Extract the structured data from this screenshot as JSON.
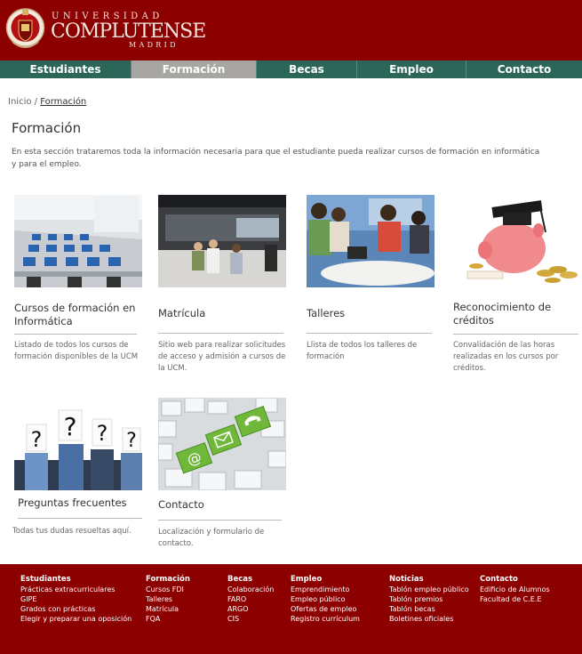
{
  "header": {
    "brand_top": "UNIVERSIDAD",
    "brand_main": "COMPLUTENSE",
    "brand_bottom": "MADRID"
  },
  "nav": {
    "items": [
      {
        "label": "Estudiantes"
      },
      {
        "label": "Formación"
      },
      {
        "label": "Becas"
      },
      {
        "label": "Empleo"
      },
      {
        "label": "Contacto"
      }
    ],
    "active": "Formación"
  },
  "breadcrumb": {
    "home": "Inicio",
    "sep": "/",
    "current": "Formación"
  },
  "page": {
    "title": "Formación",
    "intro": "En esta sección trataremos toda la información necesaria para que el estudiante pueda realizar cursos de formación en informática y para el empleo."
  },
  "cards": [
    {
      "title": "Cursos de formación en Informática",
      "desc": "Listado de todos los cursos de formación disponibles de la UCM"
    },
    {
      "title": "Matrícula",
      "desc": "Sitio web para realizar solicitudes de acceso y admisión a cursos de la UCM."
    },
    {
      "title": "Talleres",
      "desc": "Llista de todos los talleres de formación"
    },
    {
      "title": "Reconocimiento de créditos",
      "desc": "Convalidación de las horas realizadas en los cursos por créditos."
    },
    {
      "title": "Preguntas frecuentes",
      "desc": "Todas tus dudas resueltas aquí."
    },
    {
      "title": "Contacto",
      "desc": "Localización y formulario de contacto."
    }
  ],
  "footer": {
    "columns": [
      {
        "heading": "Estudiantes",
        "links": [
          "Prácticas extracurriculares",
          "GIPE",
          "Grados con prácticas",
          "Elegir y preparar una oposición"
        ]
      },
      {
        "heading": "Formación",
        "links": [
          "Cursos FDI",
          "Talleres",
          "Matrícula",
          "FQA"
        ]
      },
      {
        "heading": "Becas",
        "links": [
          "Colaboración",
          "FARO",
          "ARGO",
          "CIS"
        ]
      },
      {
        "heading": "Empleo",
        "links": [
          "Emprendimiento",
          "Empleo público",
          "Ofertas de empleo",
          "Registro currículum"
        ]
      },
      {
        "heading": "Noticias",
        "links": [
          "Tablón empleo público",
          "Tablón premios",
          "Tablón becas",
          "Boletines oficiales"
        ]
      },
      {
        "heading": "Contacto",
        "links": [
          "Edificio de Alumnos",
          "Facultad de C.E.E"
        ]
      }
    ]
  },
  "colors": {
    "brand_red": "#8d0000",
    "nav_green": "#2b6659",
    "nav_active": "#a8a6a3"
  }
}
